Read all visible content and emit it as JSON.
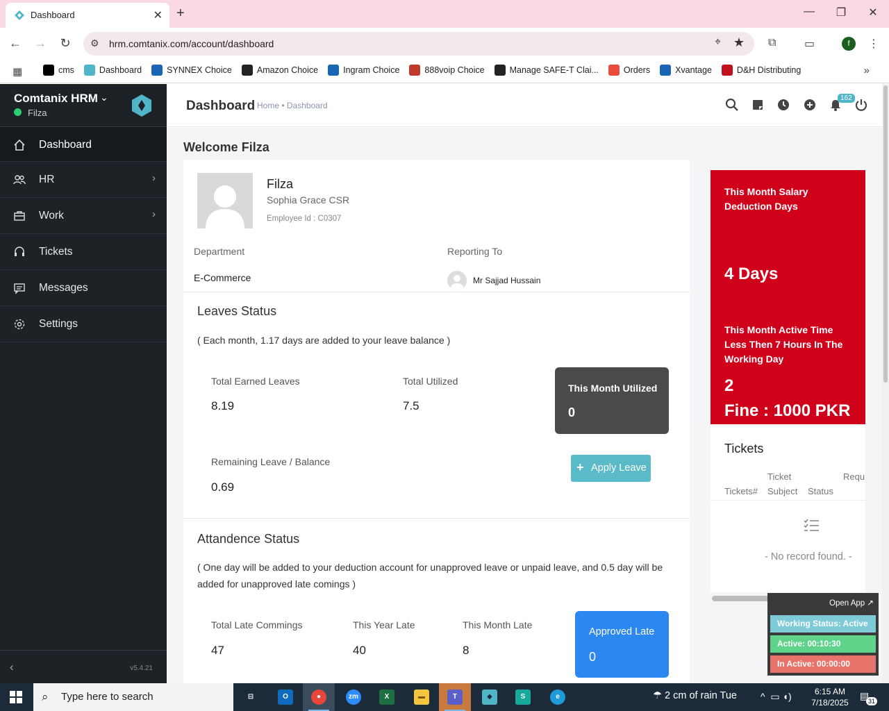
{
  "browser": {
    "tab_title": "Dashboard",
    "new_tab": "+",
    "url": "hrm.comtanix.com/account/dashboard",
    "profile_initial": "f",
    "bookmarks": [
      {
        "label": "cms",
        "icon": "triangle-icon",
        "color": "#000000"
      },
      {
        "label": "Dashboard",
        "icon": "diamond-icon",
        "color": "#4fb5c7"
      },
      {
        "label": "SYNNEX Choice",
        "icon": "sc-icon",
        "color": "#1a66b3"
      },
      {
        "label": "Amazon Choice",
        "icon": "amazon-icon",
        "color": "#222222"
      },
      {
        "label": "Ingram Choice",
        "icon": "ingram-icon",
        "color": "#1a66b3"
      },
      {
        "label": "888voip Choice",
        "icon": "voip-icon",
        "color": "#c0392b"
      },
      {
        "label": "Manage SAFE-T Clai...",
        "icon": "amazon-icon",
        "color": "#222222"
      },
      {
        "label": "Orders",
        "icon": "orders-icon",
        "color": "#e74c3c"
      },
      {
        "label": "Xvantage",
        "icon": "ingram-icon",
        "color": "#1a66b3"
      },
      {
        "label": "D&H Distributing",
        "icon": "dh-icon",
        "color": "#c0111f"
      }
    ]
  },
  "app": {
    "brand": "Comtanix HRM",
    "user": "Filza",
    "version": "v5.4.21",
    "nav": [
      {
        "label": "Dashboard",
        "icon": "home-icon",
        "active": true,
        "chevron": ""
      },
      {
        "label": "HR",
        "icon": "users-icon",
        "active": false,
        "chevron": "›"
      },
      {
        "label": "Work",
        "icon": "briefcase-icon",
        "active": false,
        "chevron": "›"
      },
      {
        "label": "Tickets",
        "icon": "headset-icon",
        "active": false,
        "chevron": ""
      },
      {
        "label": "Messages",
        "icon": "message-icon",
        "active": false,
        "chevron": ""
      },
      {
        "label": "Settings",
        "icon": "gear-icon",
        "active": false,
        "chevron": ""
      }
    ]
  },
  "header": {
    "title": "Dashboard",
    "breadcrumb": "Home • Dashboard",
    "notification_count": "162"
  },
  "main": {
    "welcome": "Welcome Filza",
    "employee": {
      "name": "Filza",
      "role": "Sophia Grace CSR",
      "id": "Employee Id : C0307",
      "department_label": "Department",
      "department": "E-Commerce",
      "reporting_label": "Reporting To",
      "reporting_to": "Mr Sajjad Hussain"
    },
    "leaves": {
      "title": "Leaves Status",
      "note": "( Each month, 1.17 days are added to your leave balance )",
      "earned_label": "Total Earned Leaves",
      "earned": "8.19",
      "utilized_label": "Total Utilized",
      "utilized": "7.5",
      "month_utilized_label": "This Month Utilized",
      "month_utilized": "0",
      "remaining_label": "Remaining Leave / Balance",
      "remaining": "0.69",
      "apply_button": "Apply Leave"
    },
    "attendance": {
      "title": "Attandence Status",
      "note": "( One day will be added to your deduction account for unapproved leave or unpaid leave, and 0.5 day will be added for unapproved late comings )",
      "late_label": "Total Late Commings",
      "late": "47",
      "year_label": "This Year Late",
      "year": "40",
      "month_label": "This Month Late",
      "month": "8",
      "approved_label": "Approved Late",
      "approved": "0"
    }
  },
  "right": {
    "salary_title": "This Month Salary Deduction Days",
    "salary_days": "4 Days",
    "active_title": "This Month Active Time Less Then 7 Hours In The Working Day",
    "active_count": "2",
    "fine": "Fine : 1000 PKR",
    "tickets_title": "Tickets",
    "ticket_cols": [
      "Tickets#",
      "Ticket Subject",
      "Status",
      "Requ"
    ],
    "empty": "- No record found. -"
  },
  "widget": {
    "open_app": "Open App ↗",
    "working": "Working Status: Active",
    "active": "Active: 00:10:30",
    "inactive": "In Active: 00:00:00",
    "colors": {
      "working": "#7ecad6",
      "active": "#5fd38a",
      "inactive": "#e8736b"
    }
  },
  "taskbar": {
    "search_placeholder": "Type here to search",
    "weather": "2 cm of rain Tue",
    "time": "6:15 AM",
    "date": "7/18/2025",
    "notifications": "31"
  },
  "colors": {
    "accent": "#4fb5c7",
    "danger": "#d0021b",
    "primary": "#2d87f0",
    "sidebar": "#1d2226"
  }
}
